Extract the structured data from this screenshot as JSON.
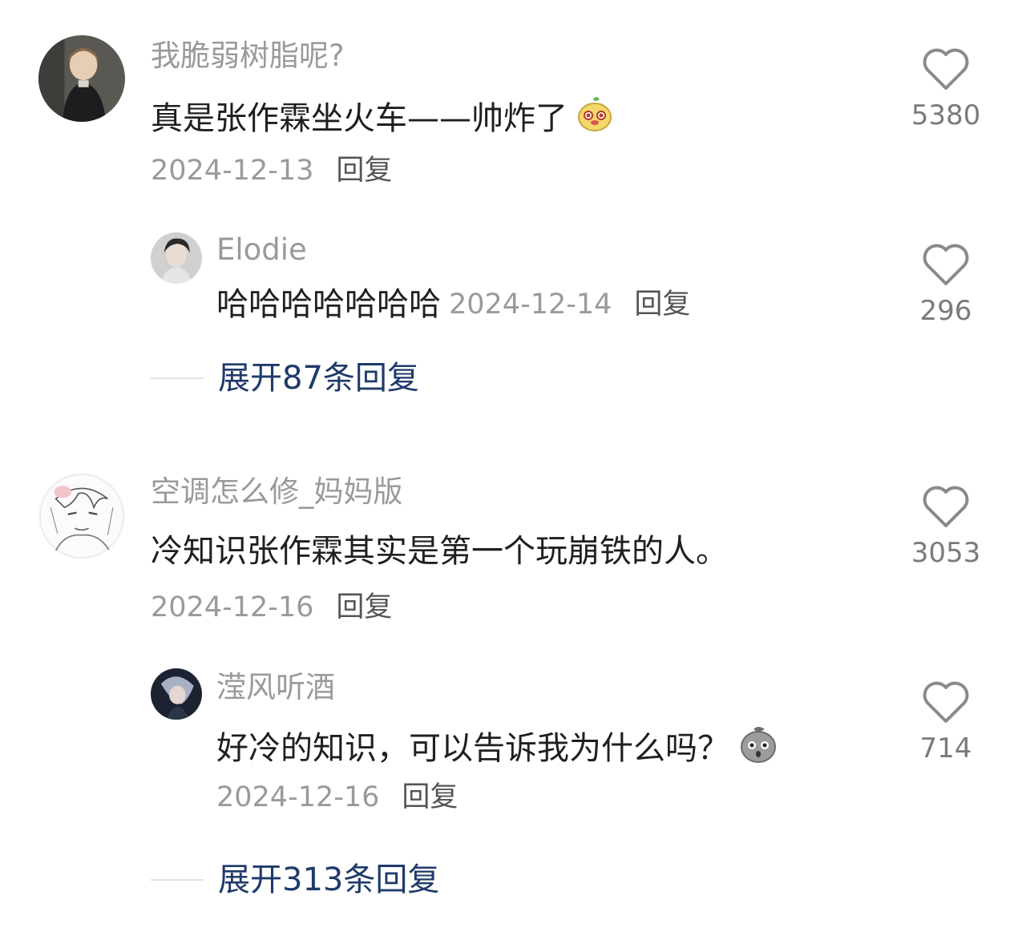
{
  "comments": [
    {
      "username": "我脆弱树脂呢?",
      "text": "真是张作霖坐火车——帅炸了",
      "date": "2024-12-13",
      "reply_label": "回复",
      "likes": "5380",
      "emoji": "yellow-mango-emoji",
      "replies": [
        {
          "username": "Elodie",
          "text": "哈哈哈哈哈哈哈",
          "date": "2024-12-14",
          "reply_label": "回复",
          "likes": "296"
        }
      ],
      "expand_label": "展开87条回复"
    },
    {
      "username": "空调怎么修_妈妈版",
      "text": "冷知识张作霖其实是第一个玩崩铁的人。",
      "date": "2024-12-16",
      "reply_label": "回复",
      "likes": "3053",
      "replies": [
        {
          "username": "滢风听酒",
          "text": "好冷的知识，可以告诉我为什么吗？",
          "date": "2024-12-16",
          "reply_label": "回复",
          "likes": "714",
          "emoji": "gray-bean-emoji"
        }
      ],
      "expand_label": "展开313条回复"
    }
  ],
  "colors": {
    "username": "#9a9a9a",
    "text": "#1f1f1f",
    "expand": "#1f3a6a",
    "heart": "#8a8a8a"
  }
}
